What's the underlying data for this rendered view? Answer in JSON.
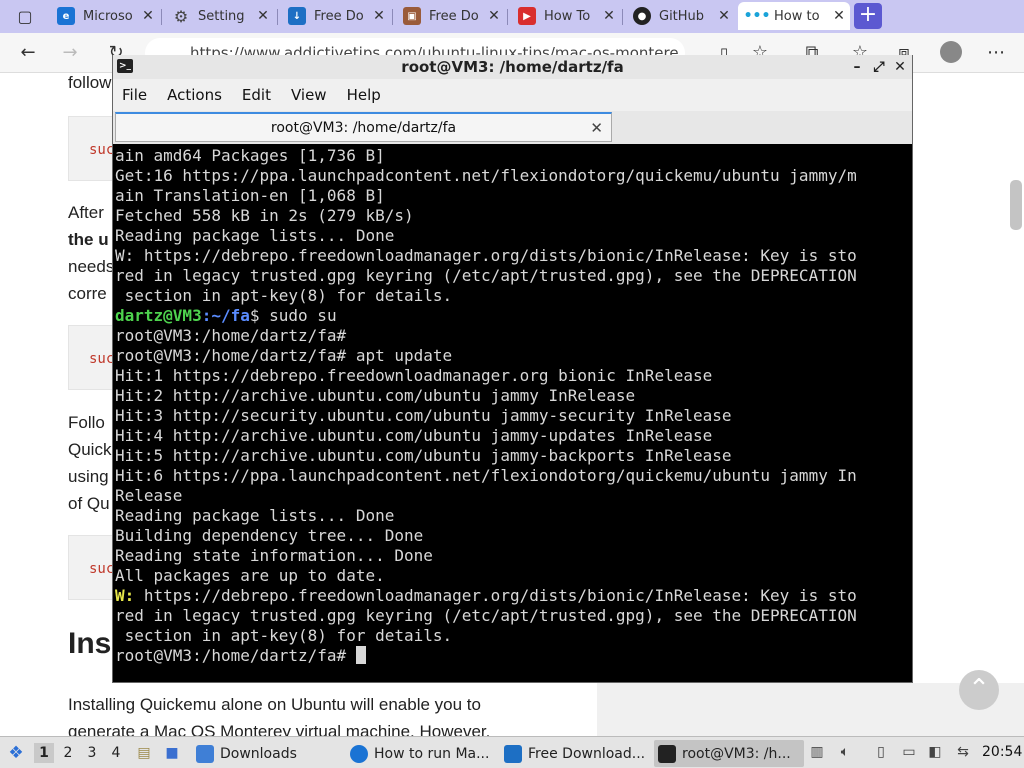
{
  "browser": {
    "tabs": [
      {
        "label": "Microso",
        "icon": "edge-icon",
        "color": "#1a73d4"
      },
      {
        "label": "Setting",
        "icon": "gear-icon",
        "color": "#555555"
      },
      {
        "label": "Free Do",
        "icon": "fdm-icon",
        "color": "#1d6fc4"
      },
      {
        "label": "Free Do",
        "icon": "page-icon",
        "color": "#9a5b3a"
      },
      {
        "label": "How To",
        "icon": "youtube-icon",
        "color": "#d92e2e"
      },
      {
        "label": "GitHub",
        "icon": "github-icon",
        "color": "#222222"
      },
      {
        "label": "How to",
        "icon": "addictive-tips-icon",
        "color": "#1aa3d9"
      }
    ],
    "url": "https://www.addictivetips.com/ubuntu-linux-tips/mac-os-montere"
  },
  "article": {
    "frag_follow": "follow",
    "frag_after": "After",
    "frag_the": "the u",
    "frag_needs": "needs",
    "frag_corre": "corre",
    "frag_follo2": "Follo",
    "frag_quick": "Quick",
    "frag_using": "using",
    "frag_ofqu": "of Qu",
    "code_frag": "suc",
    "heading_frag": "Ins",
    "para1": "Installing Quickemu alone on Ubuntu will enable you to",
    "para2": "generate a Mac OS Monterey virtual machine. However,"
  },
  "terminal": {
    "title": "root@VM3: /home/dartz/fa",
    "tab_label": "root@VM3: /home/dartz/fa",
    "menu": [
      "File",
      "Actions",
      "Edit",
      "View",
      "Help"
    ],
    "lines": [
      "ain amd64 Packages [1,736 B]",
      "Get:16 https://ppa.launchpadcontent.net/flexiondotorg/quickemu/ubuntu jammy/m",
      "ain Translation-en [1,068 B]",
      "Fetched 558 kB in 2s (279 kB/s)",
      "Reading package lists... Done",
      "W: https://debrepo.freedownloadmanager.org/dists/bionic/InRelease: Key is sto",
      "red in legacy trusted.gpg keyring (/etc/apt/trusted.gpg), see the DEPRECATION",
      " section in apt-key(8) for details."
    ],
    "prompt_user": "dartz@VM3",
    "prompt_path": ":~/fa",
    "prompt_cmd": "$ sudo su",
    "lines2": [
      "root@VM3:/home/dartz/fa#",
      "root@VM3:/home/dartz/fa# apt update",
      "Hit:1 https://debrepo.freedownloadmanager.org bionic InRelease",
      "Hit:2 http://archive.ubuntu.com/ubuntu jammy InRelease",
      "Hit:3 http://security.ubuntu.com/ubuntu jammy-security InRelease",
      "Hit:4 http://archive.ubuntu.com/ubuntu jammy-updates InRelease",
      "Hit:5 http://archive.ubuntu.com/ubuntu jammy-backports InRelease",
      "Hit:6 https://ppa.launchpadcontent.net/flexiondotorg/quickemu/ubuntu jammy In",
      "Release",
      "Reading package lists... Done",
      "Building dependency tree... Done",
      "Reading state information... Done",
      "All packages are up to date."
    ],
    "warn_prefix": "W:",
    "warn_rest": " https://debrepo.freedownloadmanager.org/dists/bionic/InRelease: Key is sto",
    "lines3": [
      "red in legacy trusted.gpg keyring (/etc/apt/trusted.gpg), see the DEPRECATION",
      " section in apt-key(8) for details."
    ],
    "final_prompt": "root@VM3:/home/dartz/fa# "
  },
  "taskbar": {
    "workspaces": [
      "1",
      "2",
      "3",
      "4"
    ],
    "tasks": [
      {
        "label": "Downloads",
        "icon": "folder-icon"
      },
      {
        "label": "How to run Ma...",
        "icon": "edge-icon"
      },
      {
        "label": "Free Download...",
        "icon": "fdm-icon"
      },
      {
        "label": "root@VM3: /h...",
        "icon": "terminal-icon"
      }
    ],
    "clock": "20:54"
  }
}
